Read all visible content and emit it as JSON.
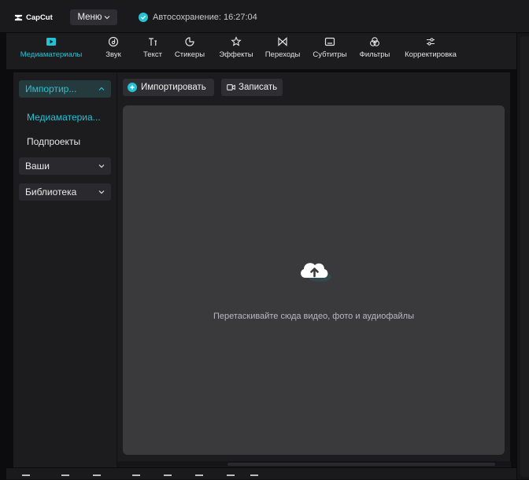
{
  "app": {
    "logo_text": "CapCut",
    "menu_label": "Меню",
    "autosave_text": "Автосохранение: 16:27:04",
    "accent": "#23c3d4"
  },
  "toolbar": {
    "tools": [
      {
        "label": "Медиаматериалы",
        "icon": "media-play-icon",
        "active": true
      },
      {
        "label": "Звук",
        "icon": "audio-disc-icon"
      },
      {
        "label": "Текст",
        "icon": "text-icon"
      },
      {
        "label": "Стикеры",
        "icon": "sticker-icon"
      },
      {
        "label": "Эффекты",
        "icon": "effects-star-icon"
      },
      {
        "label": "Переходы",
        "icon": "transition-bowtie-icon"
      },
      {
        "label": "Субтитры",
        "icon": "subtitles-icon"
      },
      {
        "label": "Фильтры",
        "icon": "filters-icon"
      },
      {
        "label": "Корректировка",
        "icon": "adjust-sliders-icon"
      }
    ]
  },
  "sidebar": {
    "header": "Импортир...",
    "items": [
      {
        "label": "Медиаматериа...",
        "active": true
      },
      {
        "label": "Подпроекты"
      }
    ],
    "dropdowns": [
      {
        "label": "Ваши"
      },
      {
        "label": "Библиотека"
      }
    ]
  },
  "main": {
    "import_label": "Импортировать",
    "record_label": "Записать",
    "dropzone_text": "Перетаскивайте сюда видео, фото и аудиофайлы",
    "dropzone_icon": "cloud-upload-icon"
  }
}
